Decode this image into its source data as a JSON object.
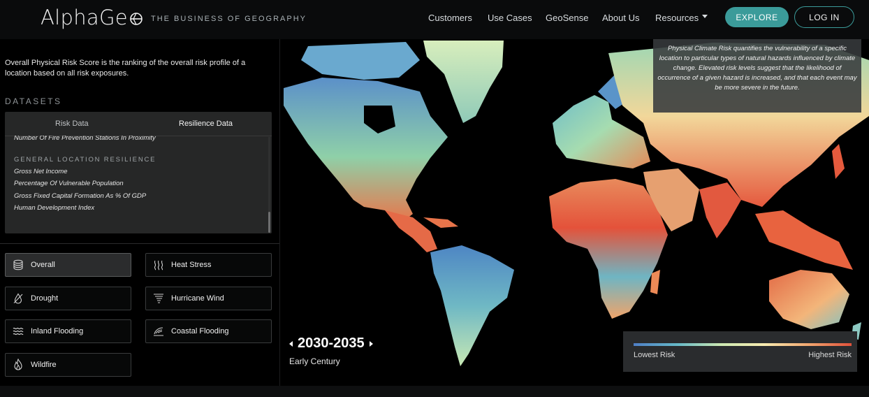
{
  "header": {
    "logo_text": "AlphaGe",
    "tagline": "THE BUSINESS OF GEOGRAPHY",
    "nav": [
      "Customers",
      "Use Cases",
      "GeoSense",
      "About Us",
      "Resources"
    ],
    "explore_label": "EXPLORE",
    "login_label": "LOG IN"
  },
  "sidebar": {
    "description": "Overall Physical Risk Score is the ranking of the overall risk profile of a location based on all risk exposures.",
    "datasets_heading": "DATASETS",
    "tabs": [
      "Risk Data",
      "Resilience Data"
    ],
    "active_tab": "Resilience Data",
    "list_cut_item": "Number Of Fire Prevention Stations In Proximity",
    "group_heading": "GENERAL LOCATION RESILIENCE",
    "list_items": [
      "Gross Net Income",
      "Percentage Of Vulnerable Population",
      "Gross Fixed Capital Formation As % Of GDP",
      "Human Development Index"
    ],
    "hazards": [
      {
        "label": "Overall",
        "icon": "database-icon"
      },
      {
        "label": "Heat Stress",
        "icon": "heat-waves-icon"
      },
      {
        "label": "Drought",
        "icon": "drought-drop-icon"
      },
      {
        "label": "Hurricane Wind",
        "icon": "tornado-icon"
      },
      {
        "label": "Inland Flooding",
        "icon": "water-waves-icon"
      },
      {
        "label": "Coastal Flooding",
        "icon": "coastal-wave-icon"
      },
      {
        "label": "Wildfire",
        "icon": "flame-icon"
      }
    ],
    "active_hazard": "Overall"
  },
  "map": {
    "info_text": "Physical Climate Risk quantifies the vulnerability of a specific location to particular types of natural hazards influenced by climate change. Elevated risk levels suggest that the likelihood of occurrence of a given hazard is increased, and that each event may be more severe in the future.",
    "period": "2030-2035",
    "period_label": "Early Century",
    "legend_low": "Lowest Risk",
    "legend_high": "Highest Risk",
    "colors": {
      "low": "#4f7fc6",
      "mid": "#f7ebb0",
      "high": "#e0513a",
      "accent": "#3b9b9a"
    }
  }
}
